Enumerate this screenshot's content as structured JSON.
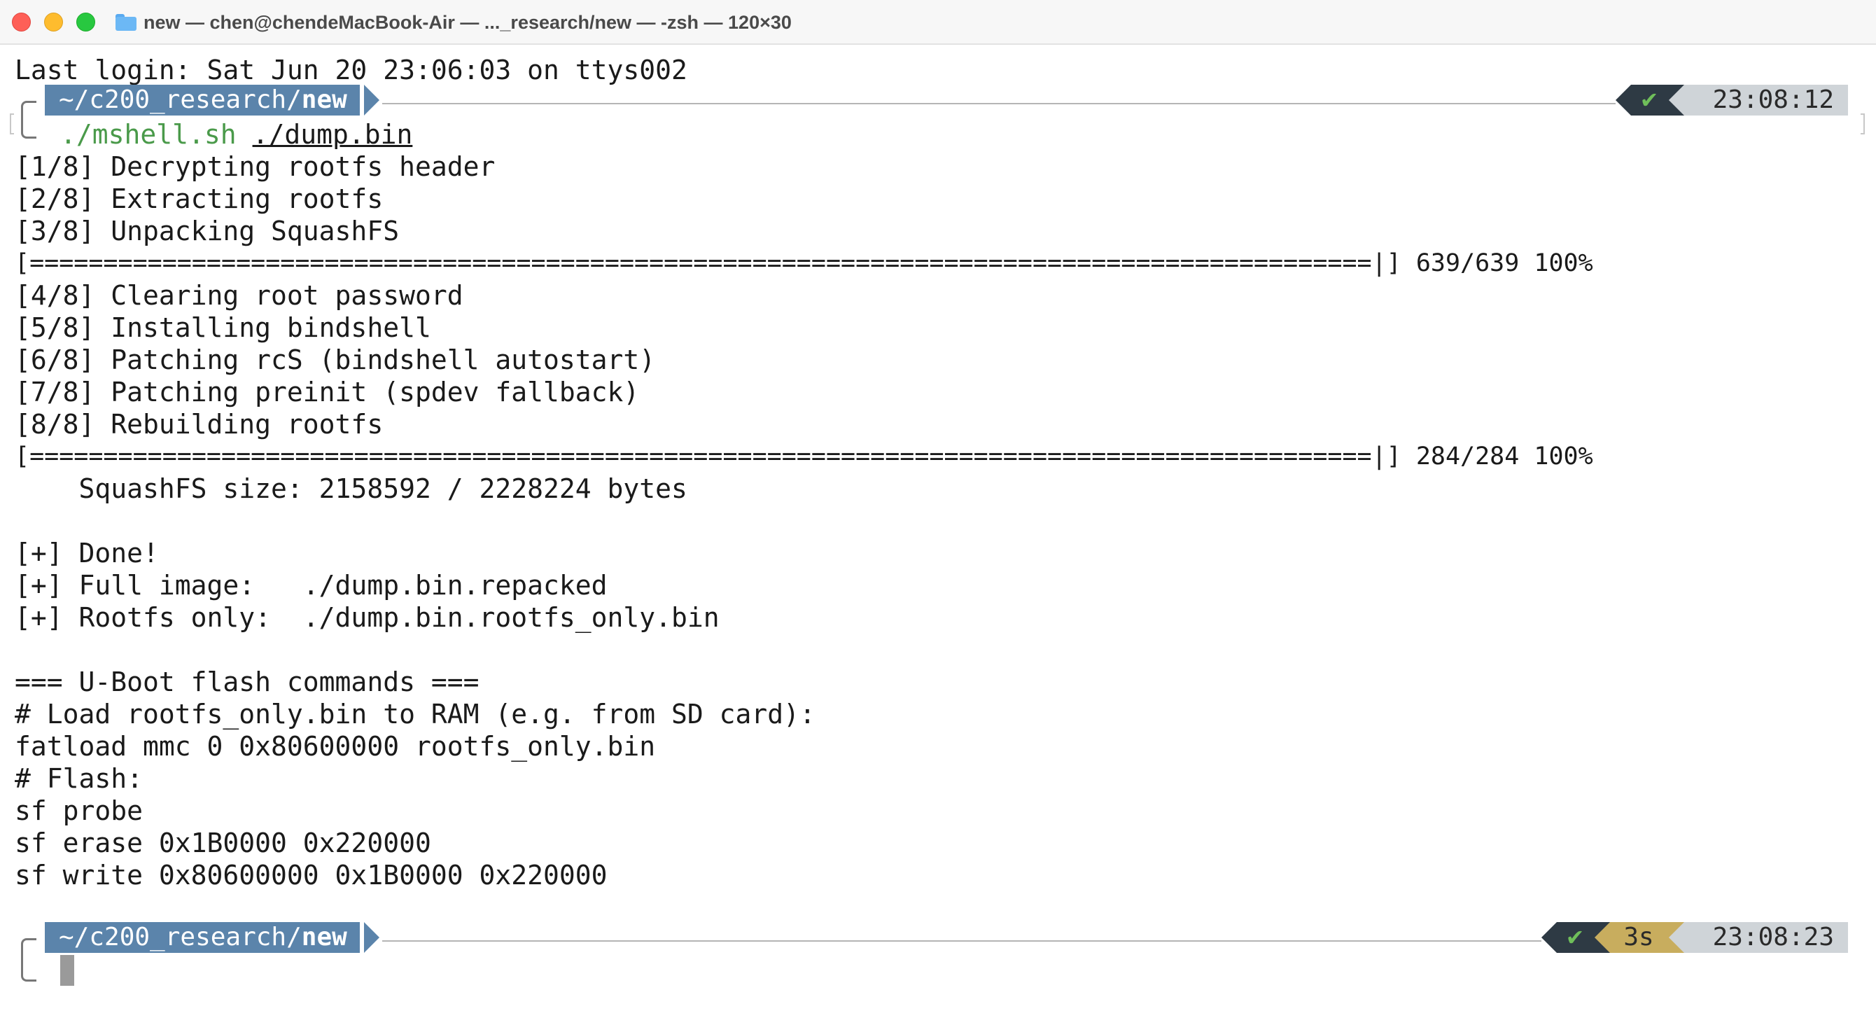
{
  "window": {
    "title": "new — chen@chendeMacBook-Air — ..._research/new — -zsh — 120×30",
    "folder_icon": "folder-icon"
  },
  "colors": {
    "prompt_dir_bg": "#5b84ab",
    "status_ok_bg": "#2e3a44",
    "status_check": "#6fbf5a",
    "duration_bg": "#c8ad5e",
    "time_bg": "#cfd4d8",
    "command_green": "#4a9a4a"
  },
  "terminal": {
    "last_login": "Last login: Sat Jun 20 23:06:03 on ttys002",
    "prompt1": {
      "dir_prefix": "~/c200_research/",
      "dir_bold": "new",
      "status_check": "✔",
      "time": "23:08:12",
      "command": "./mshell.sh",
      "argument": "./dump.bin"
    },
    "output": [
      "[1/8] Decrypting rootfs header",
      "[2/8] Extracting rootfs",
      "[3/8] Unpacking SquashFS",
      "[===========================================================================================|] 639/639 100%",
      "[4/8] Clearing root password",
      "[5/8] Installing bindshell",
      "[6/8] Patching rcS (bindshell autostart)",
      "[7/8] Patching preinit (spdev fallback)",
      "[8/8] Rebuilding rootfs",
      "[===========================================================================================|] 284/284 100%",
      "    SquashFS size: 2158592 / 2228224 bytes",
      "",
      "[+] Done!",
      "[+] Full image:   ./dump.bin.repacked",
      "[+] Rootfs only:  ./dump.bin.rootfs_only.bin",
      "",
      "=== U-Boot flash commands ===",
      "# Load rootfs_only.bin to RAM (e.g. from SD card):",
      "fatload mmc 0 0x80600000 rootfs_only.bin",
      "# Flash:",
      "sf probe",
      "sf erase 0x1B0000 0x220000",
      "sf write 0x80600000 0x1B0000 0x220000"
    ],
    "progress": [
      {
        "done": 639,
        "total": 639,
        "percent": 100
      },
      {
        "done": 284,
        "total": 284,
        "percent": 100
      }
    ],
    "prompt2": {
      "dir_prefix": "~/c200_research/",
      "dir_bold": "new",
      "status_check": "✔",
      "duration": "3s",
      "time": "23:08:23"
    }
  }
}
